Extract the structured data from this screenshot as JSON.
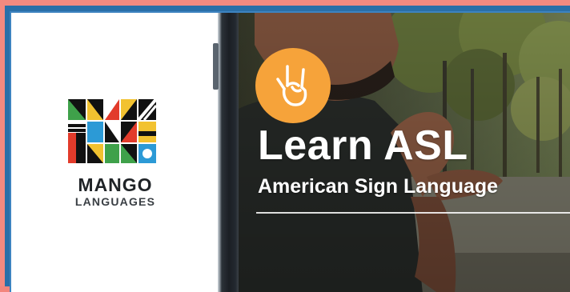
{
  "brand": {
    "name_line1": "MANGO",
    "name_line2": "LANGUAGES",
    "logo_icon": "mango-m-logo-icon"
  },
  "promo": {
    "badge_icon": "hand-sign-icon",
    "title": "Learn ASL",
    "subtitle": "American Sign Language"
  },
  "colors": {
    "outer_border": "#f38a80",
    "badge": "#f6a33a",
    "frame_blue": "#3d83c0",
    "text_dark": "#1f2327"
  }
}
